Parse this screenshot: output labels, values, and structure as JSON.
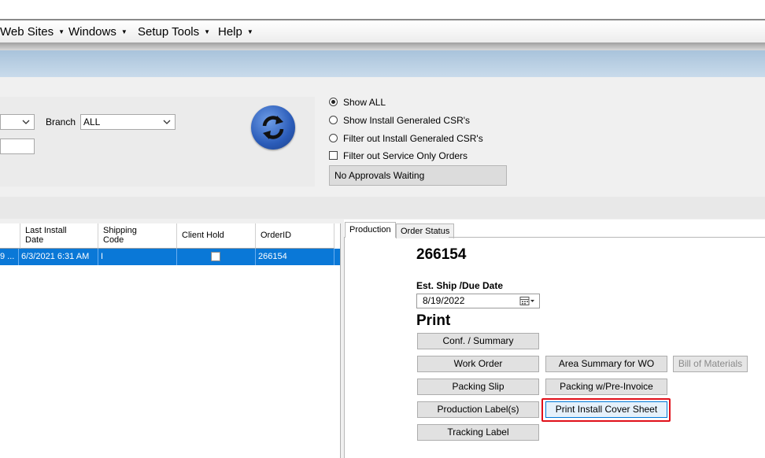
{
  "menubar": {
    "items": [
      {
        "label": "Web Sites"
      },
      {
        "label": "Windows"
      },
      {
        "label": "Setup Tools"
      },
      {
        "label": "Help"
      }
    ]
  },
  "filters": {
    "branch_label": "Branch",
    "branch_value": "ALL",
    "options": {
      "show_all": "Show ALL",
      "show_install_generated": "Show Install Generaled CSR's",
      "filter_install_generated": "Filter out Install Generaled CSR's",
      "filter_service_only": "Filter out Service Only Orders"
    },
    "approvals_status": "No Approvals Waiting"
  },
  "grid": {
    "headers": {
      "last_install_line1": "Last Install",
      "last_install_line2": "Date",
      "shipping_line1": "Shipping",
      "shipping_line2": "Code",
      "client_hold": "Client Hold",
      "order_id": "OrderID"
    },
    "row": {
      "truncated": "9 ...",
      "last_install_date": "6/3/2021 6:31 AM",
      "shipping_code": "I",
      "order_id": "266154"
    }
  },
  "tabs": {
    "production": "Production",
    "order_status": "Order Status"
  },
  "production": {
    "order_number": "266154",
    "ship_date_label": "Est. Ship /Due Date",
    "ship_date_value": "8/19/2022",
    "print_heading": "Print",
    "buttons": {
      "conf_summary": "Conf. / Summary",
      "work_order": "Work Order",
      "area_summary": "Area Summary for WO",
      "bill_of_materials": "Bill of Materials",
      "packing_slip": "Packing Slip",
      "packing_pre_invoice": "Packing w/Pre-Invoice",
      "production_labels": "Production Label(s)",
      "print_install_cover": "Print Install Cover Sheet",
      "tracking_label": "Tracking Label"
    }
  },
  "colors": {
    "selection": "#0a78d7",
    "highlight": "#e0101a"
  }
}
